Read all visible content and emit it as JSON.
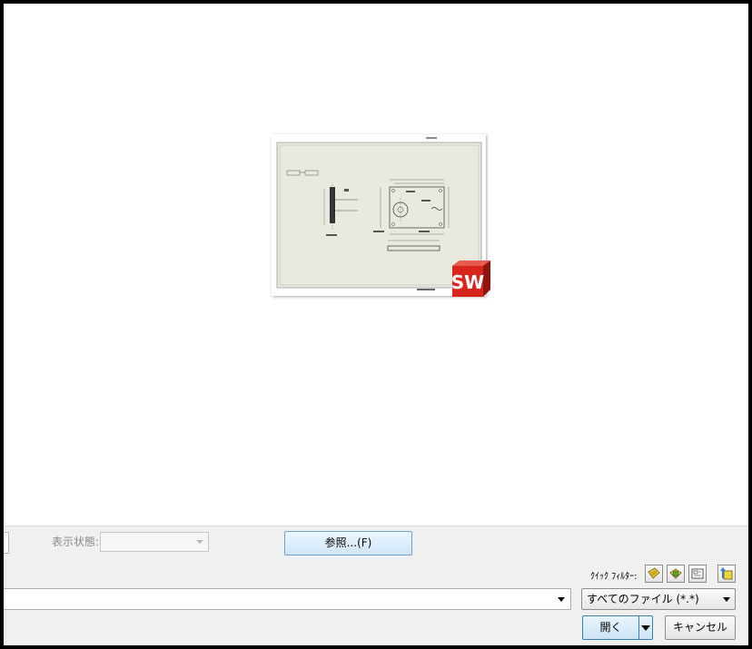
{
  "options": {
    "display_state_label": "表示状態:",
    "display_state_value": "",
    "browse_label": "参照...(F)"
  },
  "quick_filter": {
    "label": "ｸｲｯｸ ﾌｨﾙﾀｰ:",
    "buttons": [
      "filter-parts-icon",
      "filter-assemblies-icon",
      "filter-drawings-icon",
      "filter-top-level-icon"
    ]
  },
  "file": {
    "name_value": "",
    "type_value": "すべてのファイル (*.*)"
  },
  "actions": {
    "open_label": "開く",
    "cancel_label": "キャンセル"
  },
  "preview": {
    "logo_text": "SW",
    "logo_color": "#d8261d"
  }
}
